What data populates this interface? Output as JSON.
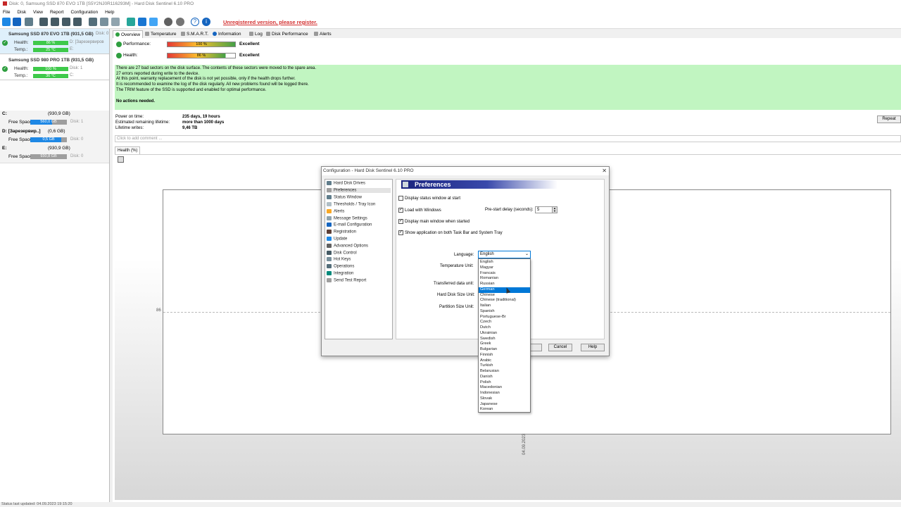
{
  "window_title": "Disk: 0, Samsung SSD 870 EVO 1TB [S5Y2NJ0R116293M]  -  Hard Disk Sentinel 6.10 PRO",
  "menu": [
    "File",
    "Disk",
    "View",
    "Report",
    "Configuration",
    "Help"
  ],
  "unregistered_text": "Unregistered version, please register.",
  "disks": [
    {
      "name": "Samsung SSD 870 EVO 1TB (931,5 GB)",
      "disk_label": "Disk: 0",
      "health_label": "Health:",
      "health_value": "86 %",
      "health_pct": 86,
      "health_right": "D: [Зарезервиров",
      "temp_label": "Temp.:",
      "temp_value": "25 °C",
      "temp_right": "E:"
    },
    {
      "name": "Samsung SSD 980 PRO 1TB (931,5 GB)",
      "disk_label": "",
      "health_label": "Health:",
      "health_value": "100 %",
      "health_pct": 100,
      "health_right": "Disk: 1",
      "temp_label": "Temp.:",
      "temp_value": "36 °C",
      "temp_right": "C:"
    }
  ],
  "volumes": [
    {
      "name": "C:",
      "size": "(930,9 GB)",
      "free_label": "Free Space",
      "free_value": "560,0 GB",
      "free_pct": 60,
      "disk": "Disk: 1"
    },
    {
      "name": "D: [Зарезервир..]",
      "size": "(0,6 GB)",
      "free_label": "Free Space",
      "free_value": "0,5 GB",
      "free_pct": 85,
      "disk": "Disk: 0"
    },
    {
      "name": "E:",
      "size": "(930,9 GB)",
      "free_label": "Free Space",
      "free_value": "930,8 GB",
      "free_pct": 100,
      "disk": "Disk: 0"
    }
  ],
  "tabs": [
    "Overview",
    "Temperature",
    "S.M.A.R.T.",
    "Information",
    "Log",
    "Disk Performance",
    "Alerts"
  ],
  "performance": {
    "label": "Performance:",
    "value": "100 %",
    "pct": 100,
    "rating": "Excellent"
  },
  "health": {
    "label": "Health:",
    "value": "86 %",
    "pct": 86,
    "rating": "Excellent"
  },
  "message_lines": [
    "There are 27 bad sectors on the disk surface. The contents of these sectors were moved to the spare area.",
    "27 errors reported during write to the device.",
    "At this point, warranty replacement of the disk is not yet possible, only if the health drops further.",
    "It is recommended to examine the log of the disk regularly. All new problems found will be logged there.",
    "The TRIM feature of the SSD is supported and enabled for optimal performance."
  ],
  "no_actions": "No actions needed.",
  "info": {
    "power_on_label": "Power on time:",
    "power_on_value": "235 days, 19 hours",
    "remaining_label": "Estimated remaining lifetime:",
    "remaining_value": "more than 1000 days",
    "writes_label": "Lifetime writes:",
    "writes_value": "9,46 TB"
  },
  "comment_placeholder": "Click to add comment ...",
  "repeat_button": "Repeat",
  "health_tab": "Health (%)",
  "chart_y_label": "86",
  "chart_x_label": "04.09.2023",
  "status_bar": "Status last updated: 04.09.2023 19:15:20",
  "dialog": {
    "title": "Configuration  -  Hard Disk Sentinel 6.10 PRO",
    "tree": [
      "Hard Disk Drives",
      "Preferences",
      "Status Window",
      "Thresholds / Tray Icon",
      "Alerts",
      "Message Settings",
      "E-mail Configuration",
      "Registration",
      "Update",
      "Advanced Options",
      "Disk Control",
      "Hot Keys",
      "Operations",
      "Integration",
      "Send Test Report"
    ],
    "panel_title": "Preferences",
    "opt_status_window": "Display status window at start",
    "opt_load_windows": "Load with Windows",
    "prestart_label": "Pre-start delay (seconds):",
    "prestart_value": "5",
    "opt_main_window": "Display main window when started",
    "opt_taskbar": "Show application on both Task Bar and System Tray",
    "language_label": "Language:",
    "language_value": "English",
    "temperature_unit_label": "Temperature Unit:",
    "transferred_unit_label": "Transferred data unit:",
    "hdd_size_label": "Hard Disk Size Unit:",
    "partition_size_label": "Partition Size Unit:",
    "languages": [
      "English",
      "Magyar",
      "Francais",
      "Romanian",
      "Russian",
      "German",
      "Chinese",
      "Chinese (traditional)",
      "Italian",
      "Spanish",
      "Portuguese-Br",
      "Czech",
      "Dutch",
      "Ukrainian",
      "Swedish",
      "Greek",
      "Bulgarian",
      "Finnish",
      "Arabic",
      "Turkish",
      "Belarusian",
      "Danish",
      "Polish",
      "Macedonian",
      "Indonesian",
      "Slovak",
      "Japanese",
      "Korean"
    ],
    "highlighted_language": "German",
    "cancel": "Cancel",
    "help": "Help"
  }
}
